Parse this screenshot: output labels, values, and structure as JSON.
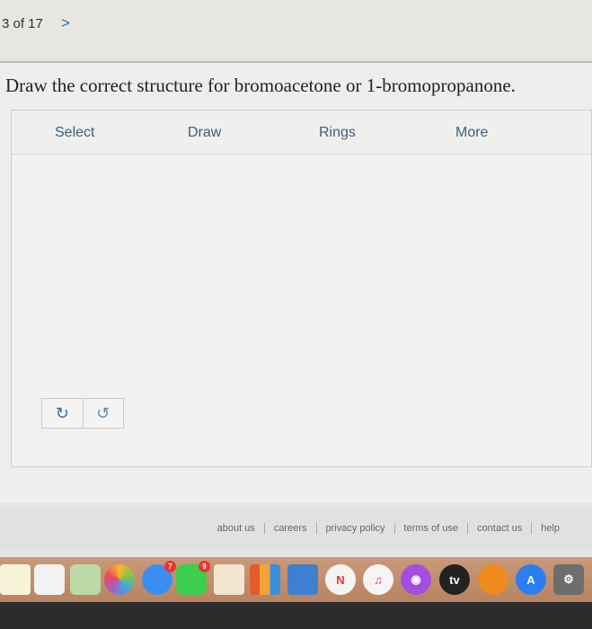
{
  "nav": {
    "counter": "3 of 17",
    "next_icon": "chevron-right-icon",
    "next_glyph": ">"
  },
  "question": "Draw the correct structure for bromoacetone or 1-bromopropanone.",
  "toolbar": {
    "items": [
      "Select",
      "Draw",
      "Rings",
      "More"
    ]
  },
  "canvas": {
    "undo_icon": "undo-icon",
    "redo_icon": "redo-icon",
    "undo_glyph": "↻",
    "redo_glyph": "↺"
  },
  "footer": {
    "links": [
      "about us",
      "careers",
      "privacy policy",
      "terms of use",
      "contact us",
      "help"
    ]
  },
  "dock": {
    "apps": [
      "notes",
      "reminders",
      "maps",
      "photos",
      "messages",
      "facetime",
      "pages",
      "numbers",
      "keynote",
      "news",
      "music",
      "podcasts",
      "tv",
      "books",
      "app-store",
      "system-preferences"
    ],
    "badges": {
      "messages": "7",
      "facetime": "9"
    },
    "tv_label": "tv",
    "news_label": "N"
  },
  "colors": {
    "accent": "#3d5f7c",
    "link": "#2e6da4"
  }
}
